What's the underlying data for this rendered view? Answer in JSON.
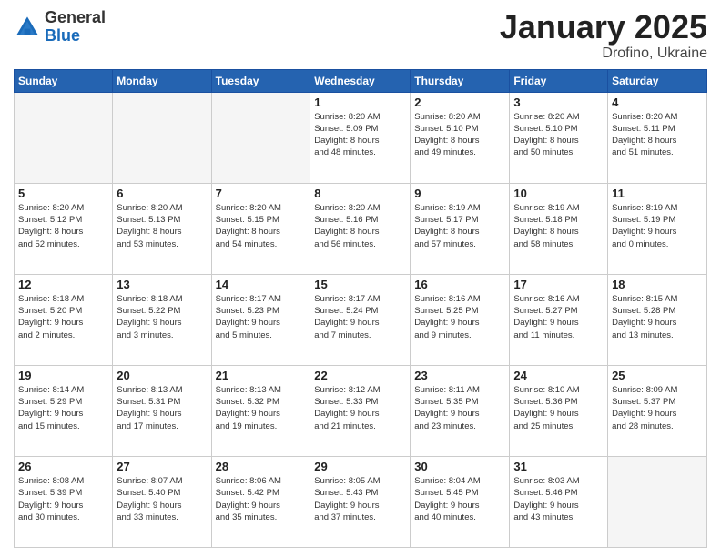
{
  "logo": {
    "general": "General",
    "blue": "Blue"
  },
  "header": {
    "title": "January 2025",
    "subtitle": "Drofino, Ukraine"
  },
  "weekdays": [
    "Sunday",
    "Monday",
    "Tuesday",
    "Wednesday",
    "Thursday",
    "Friday",
    "Saturday"
  ],
  "weeks": [
    [
      {
        "day": "",
        "info": ""
      },
      {
        "day": "",
        "info": ""
      },
      {
        "day": "",
        "info": ""
      },
      {
        "day": "1",
        "info": "Sunrise: 8:20 AM\nSunset: 5:09 PM\nDaylight: 8 hours\nand 48 minutes."
      },
      {
        "day": "2",
        "info": "Sunrise: 8:20 AM\nSunset: 5:10 PM\nDaylight: 8 hours\nand 49 minutes."
      },
      {
        "day": "3",
        "info": "Sunrise: 8:20 AM\nSunset: 5:10 PM\nDaylight: 8 hours\nand 50 minutes."
      },
      {
        "day": "4",
        "info": "Sunrise: 8:20 AM\nSunset: 5:11 PM\nDaylight: 8 hours\nand 51 minutes."
      }
    ],
    [
      {
        "day": "5",
        "info": "Sunrise: 8:20 AM\nSunset: 5:12 PM\nDaylight: 8 hours\nand 52 minutes."
      },
      {
        "day": "6",
        "info": "Sunrise: 8:20 AM\nSunset: 5:13 PM\nDaylight: 8 hours\nand 53 minutes."
      },
      {
        "day": "7",
        "info": "Sunrise: 8:20 AM\nSunset: 5:15 PM\nDaylight: 8 hours\nand 54 minutes."
      },
      {
        "day": "8",
        "info": "Sunrise: 8:20 AM\nSunset: 5:16 PM\nDaylight: 8 hours\nand 56 minutes."
      },
      {
        "day": "9",
        "info": "Sunrise: 8:19 AM\nSunset: 5:17 PM\nDaylight: 8 hours\nand 57 minutes."
      },
      {
        "day": "10",
        "info": "Sunrise: 8:19 AM\nSunset: 5:18 PM\nDaylight: 8 hours\nand 58 minutes."
      },
      {
        "day": "11",
        "info": "Sunrise: 8:19 AM\nSunset: 5:19 PM\nDaylight: 9 hours\nand 0 minutes."
      }
    ],
    [
      {
        "day": "12",
        "info": "Sunrise: 8:18 AM\nSunset: 5:20 PM\nDaylight: 9 hours\nand 2 minutes."
      },
      {
        "day": "13",
        "info": "Sunrise: 8:18 AM\nSunset: 5:22 PM\nDaylight: 9 hours\nand 3 minutes."
      },
      {
        "day": "14",
        "info": "Sunrise: 8:17 AM\nSunset: 5:23 PM\nDaylight: 9 hours\nand 5 minutes."
      },
      {
        "day": "15",
        "info": "Sunrise: 8:17 AM\nSunset: 5:24 PM\nDaylight: 9 hours\nand 7 minutes."
      },
      {
        "day": "16",
        "info": "Sunrise: 8:16 AM\nSunset: 5:25 PM\nDaylight: 9 hours\nand 9 minutes."
      },
      {
        "day": "17",
        "info": "Sunrise: 8:16 AM\nSunset: 5:27 PM\nDaylight: 9 hours\nand 11 minutes."
      },
      {
        "day": "18",
        "info": "Sunrise: 8:15 AM\nSunset: 5:28 PM\nDaylight: 9 hours\nand 13 minutes."
      }
    ],
    [
      {
        "day": "19",
        "info": "Sunrise: 8:14 AM\nSunset: 5:29 PM\nDaylight: 9 hours\nand 15 minutes."
      },
      {
        "day": "20",
        "info": "Sunrise: 8:13 AM\nSunset: 5:31 PM\nDaylight: 9 hours\nand 17 minutes."
      },
      {
        "day": "21",
        "info": "Sunrise: 8:13 AM\nSunset: 5:32 PM\nDaylight: 9 hours\nand 19 minutes."
      },
      {
        "day": "22",
        "info": "Sunrise: 8:12 AM\nSunset: 5:33 PM\nDaylight: 9 hours\nand 21 minutes."
      },
      {
        "day": "23",
        "info": "Sunrise: 8:11 AM\nSunset: 5:35 PM\nDaylight: 9 hours\nand 23 minutes."
      },
      {
        "day": "24",
        "info": "Sunrise: 8:10 AM\nSunset: 5:36 PM\nDaylight: 9 hours\nand 25 minutes."
      },
      {
        "day": "25",
        "info": "Sunrise: 8:09 AM\nSunset: 5:37 PM\nDaylight: 9 hours\nand 28 minutes."
      }
    ],
    [
      {
        "day": "26",
        "info": "Sunrise: 8:08 AM\nSunset: 5:39 PM\nDaylight: 9 hours\nand 30 minutes."
      },
      {
        "day": "27",
        "info": "Sunrise: 8:07 AM\nSunset: 5:40 PM\nDaylight: 9 hours\nand 33 minutes."
      },
      {
        "day": "28",
        "info": "Sunrise: 8:06 AM\nSunset: 5:42 PM\nDaylight: 9 hours\nand 35 minutes."
      },
      {
        "day": "29",
        "info": "Sunrise: 8:05 AM\nSunset: 5:43 PM\nDaylight: 9 hours\nand 37 minutes."
      },
      {
        "day": "30",
        "info": "Sunrise: 8:04 AM\nSunset: 5:45 PM\nDaylight: 9 hours\nand 40 minutes."
      },
      {
        "day": "31",
        "info": "Sunrise: 8:03 AM\nSunset: 5:46 PM\nDaylight: 9 hours\nand 43 minutes."
      },
      {
        "day": "",
        "info": ""
      }
    ]
  ]
}
